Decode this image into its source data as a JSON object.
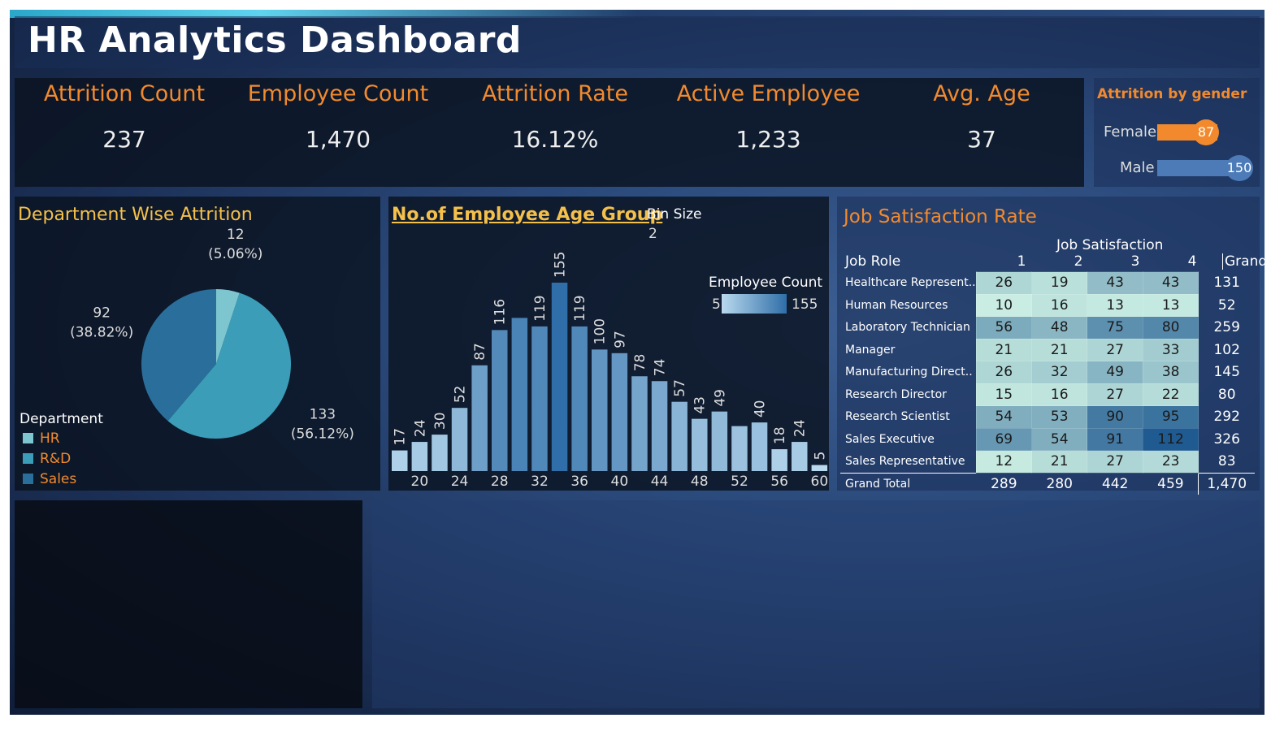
{
  "header": {
    "title": "HR Analytics Dashboard"
  },
  "kpis": [
    {
      "label": "Attrition Count",
      "value": "237"
    },
    {
      "label": "Employee Count",
      "value": "1,470"
    },
    {
      "label": "Attrition Rate",
      "value": "16.12%"
    },
    {
      "label": "Active Employee",
      "value": "1,233"
    },
    {
      "label": "Avg. Age",
      "value": "37"
    }
  ],
  "gender": {
    "title": "Attrition by gender",
    "rows": [
      {
        "label": "Female",
        "value": 87
      },
      {
        "label": "Male",
        "value": 150
      }
    ],
    "colors": {
      "female": "#f28a2d",
      "male": "#4c7bb8"
    }
  },
  "department": {
    "title": "Department Wise Attrition",
    "legend_title": "Department",
    "legend": [
      {
        "label": "HR",
        "color": "#7ec6cf"
      },
      {
        "label": "R&D",
        "color": "#3b9db8"
      },
      {
        "label": "Sales",
        "color": "#2a6f9b"
      }
    ]
  },
  "age": {
    "title": "No.of Employee Age Group",
    "bin_label": "Bin Size",
    "bin_value": "2",
    "legend_title": "Employee Count",
    "legend_min": "5",
    "legend_max": "155"
  },
  "job": {
    "title": "Job Satisfaction Rate",
    "col_group": "Job Satisfaction",
    "row_header": "Job Role",
    "columns": [
      "1",
      "2",
      "3",
      "4",
      "Grand .."
    ],
    "rows": [
      {
        "role": "Healthcare Represent..",
        "vals": [
          26,
          19,
          43,
          43
        ],
        "total": "131"
      },
      {
        "role": "Human Resources",
        "vals": [
          10,
          16,
          13,
          13
        ],
        "total": "52"
      },
      {
        "role": "Laboratory Technician",
        "vals": [
          56,
          48,
          75,
          80
        ],
        "total": "259"
      },
      {
        "role": "Manager",
        "vals": [
          21,
          21,
          27,
          33
        ],
        "total": "102"
      },
      {
        "role": "Manufacturing Direct..",
        "vals": [
          26,
          32,
          49,
          38
        ],
        "total": "145"
      },
      {
        "role": "Research Director",
        "vals": [
          15,
          16,
          27,
          22
        ],
        "total": "80"
      },
      {
        "role": "Research Scientist",
        "vals": [
          54,
          53,
          90,
          95
        ],
        "total": "292"
      },
      {
        "role": "Sales Executive",
        "vals": [
          69,
          54,
          91,
          112
        ],
        "total": "326"
      },
      {
        "role": "Sales Representative",
        "vals": [
          12,
          21,
          27,
          23
        ],
        "total": "83"
      }
    ],
    "grand_total": {
      "role": "Grand Total",
      "vals": [
        "289",
        "280",
        "442",
        "459"
      ],
      "total": "1,470"
    }
  },
  "chart_data": [
    {
      "type": "pie",
      "title": "Department Wise Attrition",
      "legend_title": "Department",
      "categories": [
        "HR",
        "R&D",
        "Sales"
      ],
      "values": [
        12,
        133,
        92
      ],
      "labels": [
        {
          "value": "12",
          "pct": "(5.06%)"
        },
        {
          "value": "133",
          "pct": "(56.12%)"
        },
        {
          "value": "92",
          "pct": "(38.82%)"
        }
      ]
    },
    {
      "type": "bar",
      "title": "No.of Employee Age Group",
      "x": [
        18,
        20,
        22,
        24,
        26,
        28,
        30,
        32,
        34,
        36,
        38,
        40,
        42,
        44,
        46,
        48,
        50,
        52,
        54,
        56,
        58,
        60
      ],
      "values": [
        17,
        24,
        30,
        52,
        87,
        116,
        null,
        119,
        155,
        119,
        100,
        97,
        78,
        74,
        57,
        43,
        49,
        null,
        40,
        18,
        24,
        5
      ],
      "heights": [
        17,
        24,
        30,
        52,
        87,
        116,
        126,
        119,
        155,
        119,
        100,
        97,
        78,
        74,
        57,
        43,
        49,
        37,
        40,
        18,
        24,
        5
      ],
      "tick_labels": [
        "20",
        "24",
        "28",
        "32",
        "36",
        "40",
        "44",
        "48",
        "52",
        "56",
        "60"
      ],
      "ylim": [
        0,
        155
      ],
      "color_scale": {
        "min": 5,
        "max": 155,
        "label": "Employee Count"
      }
    }
  ]
}
